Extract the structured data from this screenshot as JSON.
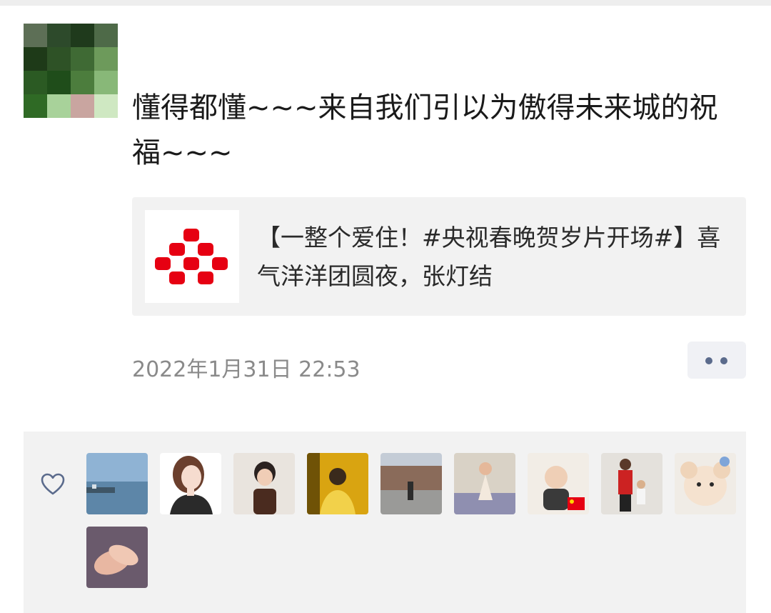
{
  "post": {
    "text": "懂得都懂~~~来自我们引以为傲得未来城的祝福~~~",
    "link": {
      "title": "【一整个爱住！#央视春晚贺岁片开场#】喜气洋洋团圆夜，张灯结"
    },
    "timestamp": "2022年1月31日 22:53",
    "more_icon": "ellipsis-icon"
  },
  "colors": {
    "link_bg": "#f2f2f2",
    "likes_bg": "#f2f2f2",
    "meta_text": "#8a8a8a",
    "accent_blue": "#5b6b8c",
    "logo_red": "#e60012"
  },
  "likes": {
    "icon": "heart-outline-icon",
    "avatars": [
      "lake-scene-avatar",
      "illustrated-woman-avatar",
      "girl-photo-avatar",
      "man-singing-avatar",
      "street-scene-avatar",
      "child-flowers-avatar",
      "baby-flag-avatar",
      "boy-photo-avatar",
      "plush-toy-avatar",
      "holding-hands-avatar"
    ]
  }
}
